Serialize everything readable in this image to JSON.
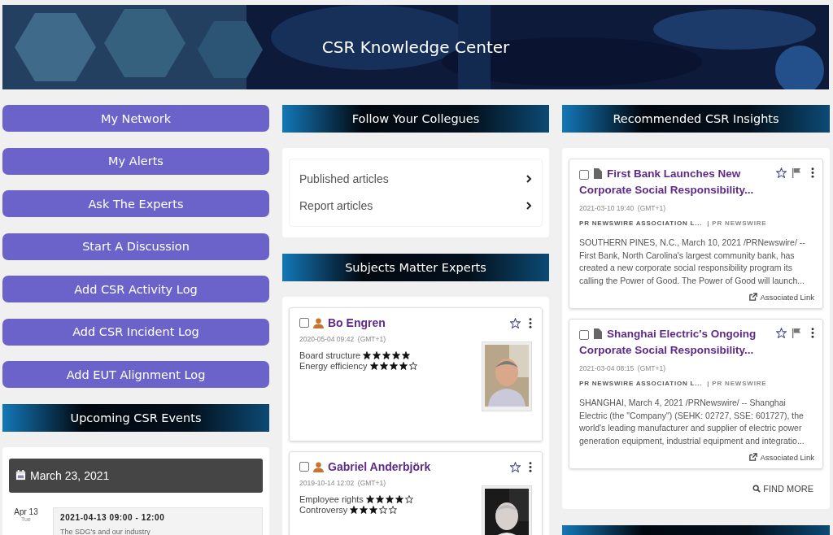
{
  "header": {
    "title": "CSR Knowledge Center"
  },
  "actions": [
    "My Network",
    "My Alerts",
    "Ask The Experts",
    "Start A Discussion",
    "Add CSR Activity Log",
    "Add CSR Incident Log",
    "Add EUT Alignment Log"
  ],
  "events": {
    "heading": "Upcoming CSR Events",
    "date": "March 23, 2021",
    "items": [
      {
        "day": "Apr 13",
        "weekday": "Tue",
        "time": "2021-04-13 09:00 - 12:00",
        "title": "The SDG's and our industry"
      }
    ]
  },
  "colleagues": {
    "heading": "Follow Your Collegues",
    "links": [
      "Published articles",
      "Report articles"
    ]
  },
  "experts": {
    "heading": "Subjects Matter Experts",
    "items": [
      {
        "name": "Bo Engren",
        "checked": false,
        "date": "2020-05-04 09:42",
        "tz": "(GMT+1)",
        "ratings": [
          {
            "label": "Board structure",
            "stars": 5
          },
          {
            "label": "Energy efficiency",
            "stars": 4
          }
        ]
      },
      {
        "name": "Gabriel Anderbjörk",
        "checked": false,
        "date": "2019-10-14 12:02",
        "tz": "(GMT+1)",
        "ratings": [
          {
            "label": "Employee rights",
            "stars": 4
          },
          {
            "label": "Controversy",
            "stars": 3
          }
        ]
      }
    ]
  },
  "insights": {
    "heading": "Recommended CSR Insights",
    "items": [
      {
        "checked": false,
        "title": "First Bank Launches New Corporate Social Responsibility...",
        "date": "2021-03-10 19:40",
        "tz": "(GMT+1)",
        "source": "PR NEWSWIRE ASSOCIATION L...",
        "publisher": "| PR NEWSWIRE",
        "summary": "SOUTHERN PINES, N.C., March 10, 2021 /PRNewswire/ -- First Bank, North Carolina's largest community bank, has created a new corporate social responsibility program its calling the Power of Good. The Power of Good will launch...",
        "link": "Associated Link"
      },
      {
        "checked": false,
        "title": "Shanghai Electric's Ongoing Corporate Social Responsibility...",
        "date": "2021-03-04 08:15",
        "tz": "(GMT+1)",
        "source": "PR NEWSWIRE ASSOCIATION L...",
        "publisher": "| PR NEWSWIRE",
        "summary": "SHANGHAI, March 4, 2021 /PRNewswire/ -- Shanghai Electric (the \"Company\") (SEHK: 02727, SSE: 601727), the world's leading manufacturer and supplier of electric power generation equipment, industrial equipment and integratio...",
        "link": "Associated Link"
      }
    ],
    "find_more": "FIND MORE"
  }
}
